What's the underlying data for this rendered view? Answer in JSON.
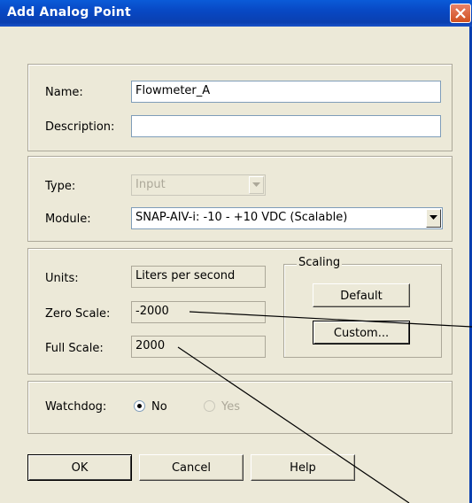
{
  "window": {
    "title": "Add Analog Point"
  },
  "identity": {
    "name_label": "Name:",
    "name_value": "Flowmeter_A",
    "description_label": "Description:",
    "description_value": ""
  },
  "hardware": {
    "type_label": "Type:",
    "type_value": "Input",
    "module_label": "Module:",
    "module_value": "SNAP-AIV-i: -10 - +10 VDC (Scalable)"
  },
  "scaling_section": {
    "units_label": "Units:",
    "units_value": "Liters per second",
    "zero_label": "Zero Scale:",
    "zero_value": "-2000",
    "full_label": "Full Scale:",
    "full_value": "2000",
    "scaling_group_label": "Scaling",
    "default_button": "Default",
    "custom_button": "Custom..."
  },
  "watchdog": {
    "label": "Watchdog:",
    "no_label": "No",
    "yes_label": "Yes",
    "selected": "No"
  },
  "buttons": {
    "ok": "OK",
    "cancel": "Cancel",
    "help": "Help"
  },
  "colors": {
    "titlebar": "#0a3fb0",
    "dialog_bg": "#ece9d8",
    "close_button": "#d1501f"
  },
  "icons": {
    "close": "close-x-icon",
    "dropdown": "chevron-down-icon"
  }
}
